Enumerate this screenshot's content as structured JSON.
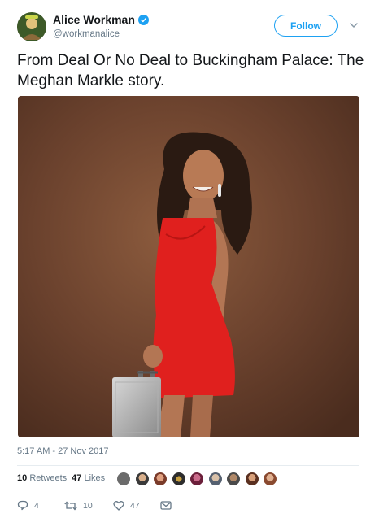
{
  "user": {
    "display_name": "Alice Workman",
    "handle": "@workmanalice",
    "verified": true,
    "avatar_icon": "avatar-photo"
  },
  "header": {
    "follow_label": "Follow",
    "menu_icon": "chevron-down-icon"
  },
  "tweet": {
    "text": "From Deal Or No Deal to Buckingham Palace: The Meghan Markle story.",
    "photo_icon": "photo-woman-red-dress-briefcase",
    "timestamp": "5:17 AM - 27 Nov 2017"
  },
  "stats": {
    "retweets_count": "10",
    "retweets_label": "Retweets",
    "likes_count": "47",
    "likes_label": "Likes",
    "liker_avatar_count": 9
  },
  "actions": {
    "reply_count": "4",
    "retweet_count": "10",
    "like_count": "47",
    "reply_icon": "reply-icon",
    "retweet_icon": "retweet-icon",
    "like_icon": "heart-icon",
    "dm_icon": "envelope-icon"
  },
  "colors": {
    "accent": "#1da1f2",
    "text": "#14171a",
    "muted": "#657786",
    "divider": "#e6ecf0",
    "photo_background": "#6e4430",
    "dress": "#e0201e"
  }
}
